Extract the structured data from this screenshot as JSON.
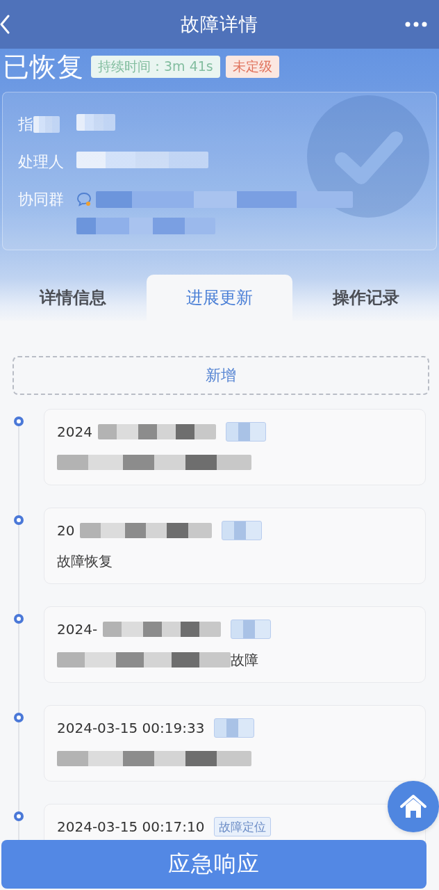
{
  "header": {
    "title": "故障详情"
  },
  "status": {
    "title": "已恢复",
    "badges": [
      {
        "kind": "duration",
        "label": "持续时间：3m 41s"
      },
      {
        "kind": "level",
        "label": "未定级"
      }
    ]
  },
  "info": {
    "rows": [
      {
        "kind": "text",
        "label": "指",
        "label_masked": true,
        "value_masked": true
      },
      {
        "kind": "text",
        "label": "处理人",
        "label_masked": false,
        "value_masked": true
      },
      {
        "kind": "group",
        "label": "协同群",
        "label_masked": false,
        "value_masked": true
      }
    ]
  },
  "tabs": [
    {
      "label": "详情信息",
      "selected": false
    },
    {
      "label": "进展更新",
      "selected": true
    },
    {
      "label": "操作记录",
      "selected": false
    }
  ],
  "add_button": {
    "label": "新增"
  },
  "timeline": [
    {
      "time": "2024",
      "time_masked": true,
      "tag": {
        "masked": true
      },
      "note_masked": true
    },
    {
      "time": "20",
      "time_masked": true,
      "tag": {
        "masked": true
      },
      "note": "故障恢复",
      "note_masked": false
    },
    {
      "time": "2024-",
      "time_masked": true,
      "tag": {
        "masked": true
      },
      "note": "故障",
      "note_masked": true
    },
    {
      "time": "2024-03-15 00:19:33",
      "time_masked": false,
      "tag": {
        "masked": true
      },
      "note_masked": true
    },
    {
      "time": "2024-03-15 00:17:10",
      "time_masked": false,
      "tag": {
        "label": "故障定位",
        "masked": false
      }
    }
  ],
  "primary_action": {
    "label": "应急响应"
  }
}
